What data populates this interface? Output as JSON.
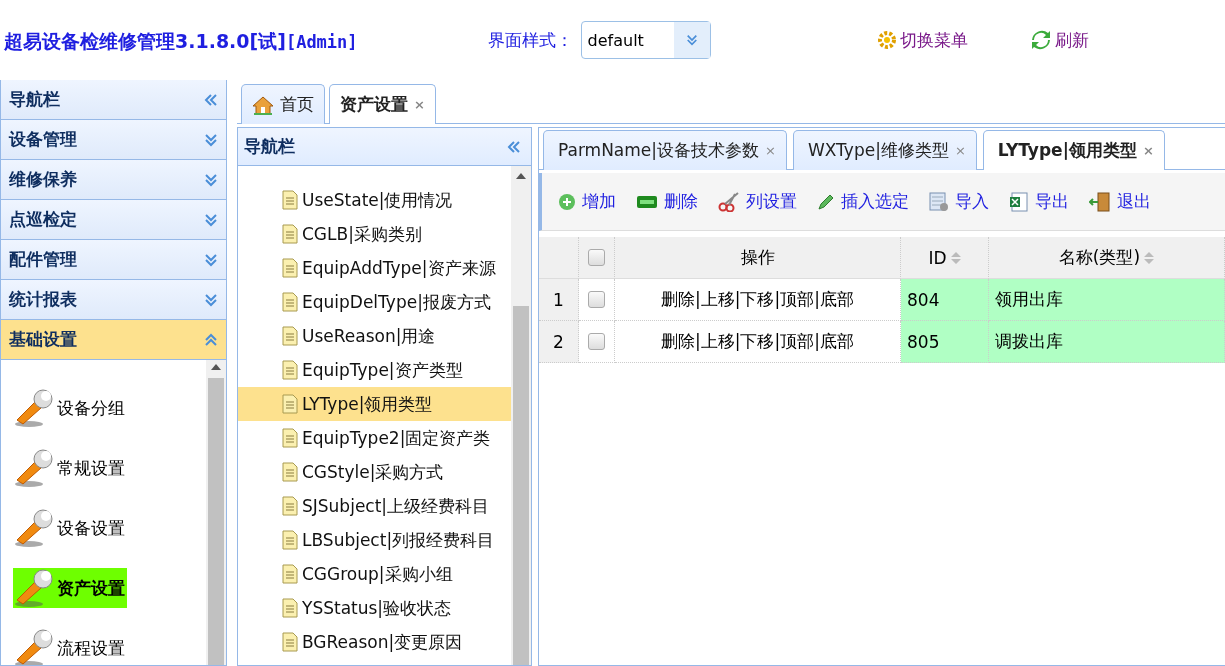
{
  "app": {
    "title": "超易设备检维修管理3.1.8.0[试]",
    "user": "[Admin]"
  },
  "style_selector": {
    "label": "界面样式：",
    "value": "default"
  },
  "header_actions": [
    {
      "label": "切换菜单",
      "kind": "switch"
    },
    {
      "label": "刷新",
      "kind": "refresh"
    }
  ],
  "sidebar": {
    "title": "导航栏",
    "sections": [
      {
        "label": "设备管理",
        "expanded": false
      },
      {
        "label": "维修保养",
        "expanded": false
      },
      {
        "label": "点巡检定",
        "expanded": false
      },
      {
        "label": "配件管理",
        "expanded": false
      },
      {
        "label": "统计报表",
        "expanded": false
      },
      {
        "label": "基础设置",
        "expanded": true
      }
    ],
    "items": [
      {
        "label": "设备分组",
        "selected": false
      },
      {
        "label": "常规设置",
        "selected": false
      },
      {
        "label": "设备设置",
        "selected": false
      },
      {
        "label": "资产设置",
        "selected": true
      },
      {
        "label": "流程设置",
        "selected": false
      }
    ]
  },
  "page_tabs": [
    {
      "label": "首页",
      "kind": "home",
      "selected": false
    },
    {
      "label": "资产设置",
      "kind": "closable",
      "selected": true,
      "close": "×"
    }
  ],
  "tree": {
    "title": "导航栏",
    "items": [
      {
        "label": "UseState|使用情况",
        "selected": false
      },
      {
        "label": "CGLB|采购类别",
        "selected": false
      },
      {
        "label": "EquipAddType|资产来源",
        "selected": false
      },
      {
        "label": "EquipDelType|报废方式",
        "selected": false
      },
      {
        "label": "UseReason|用途",
        "selected": false
      },
      {
        "label": "EquipType|资产类型",
        "selected": false
      },
      {
        "label": "LYType|领用类型",
        "selected": true
      },
      {
        "label": "EquipType2|固定资产类",
        "selected": false
      },
      {
        "label": "CGStyle|采购方式",
        "selected": false
      },
      {
        "label": "SJSubject|上级经费科目",
        "selected": false
      },
      {
        "label": "LBSubject|列报经费科目",
        "selected": false
      },
      {
        "label": "CGGroup|采购小组",
        "selected": false
      },
      {
        "label": "YSStatus|验收状态",
        "selected": false
      },
      {
        "label": "BGReason|变更原因",
        "selected": false
      }
    ]
  },
  "sub_tabs": [
    {
      "label": "ParmName|设备技术参数",
      "selected": false,
      "close": "×"
    },
    {
      "label": "WXType|维修类型",
      "selected": false,
      "close": "×"
    },
    {
      "label": "LYType|领用类型",
      "selected": true,
      "close": "×"
    }
  ],
  "toolbar": [
    {
      "label": "增加",
      "kind": "add"
    },
    {
      "label": "删除",
      "kind": "delete"
    },
    {
      "label": "列设置",
      "kind": "columns"
    },
    {
      "label": "插入选定",
      "kind": "insert"
    },
    {
      "label": "导入",
      "kind": "import"
    },
    {
      "label": "导出",
      "kind": "export"
    },
    {
      "label": "退出",
      "kind": "exit"
    }
  ],
  "table": {
    "header_checked": false,
    "columns": [
      "操作",
      "ID",
      "名称(类型)"
    ],
    "rows": [
      {
        "number": "1",
        "checked": false,
        "actions": "删除|上移|下移|顶部|底部",
        "id": "804",
        "name": "领用出库"
      },
      {
        "number": "2",
        "checked": false,
        "actions": "删除|上移|下移|顶部|底部",
        "id": "805",
        "name": "调拨出库"
      }
    ]
  }
}
